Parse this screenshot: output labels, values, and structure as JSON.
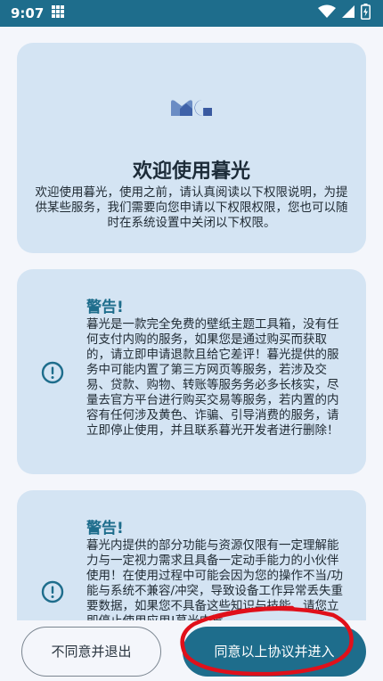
{
  "status_bar": {
    "time": "9:07"
  },
  "welcome": {
    "title": "欢迎使用暮光",
    "body": "欢迎使用暮光，使用之前，请认真阅读以下权限说明，为提供某些服务，我们需要向您申请以下权限权限，您也可以随时在系统设置中关闭以下权限。"
  },
  "warnings": [
    {
      "title": "警告!",
      "body": "暮光是一款完全免费的壁纸主题工具箱，没有任何支付内购的服务，如果您是通过购买而获取的，请立即申请退款且给它差评！暮光提供的服务中可能内置了第三方网页等服务，若涉及交易、贷款、购物、转账等服务务必多长核实，尽量去官方平台进行购买交易等服务，若内置的内容有任何涉及黄色、诈骗、引导消费的服务，请立即停止使用，并且联系暮光开发者进行删除！"
    },
    {
      "title": "警告!",
      "body": "暮光内提供的部分功能与资源仅限有一定理解能力与一定视力需求且具备一定动手能力的小伙伴使用！在使用过程中可能会因为您的操作不当/功能与系统不兼容/冲突，导致设备工作异常丢失重要数据，如果您不具备这些知识与技能，请您立即停止使用应用!暮光内置"
    }
  ],
  "buttons": {
    "decline": "不同意并退出",
    "accept": "同意以上协议并进入"
  },
  "colors": {
    "primary": "#1e6d8c",
    "card": "#d4e4f3",
    "background": "#f4f6fb",
    "annotation": "#e0101a"
  },
  "icons": [
    "grid-icon",
    "wifi-icon",
    "signal-icon",
    "battery-icon",
    "app-logo",
    "warning-icon"
  ]
}
